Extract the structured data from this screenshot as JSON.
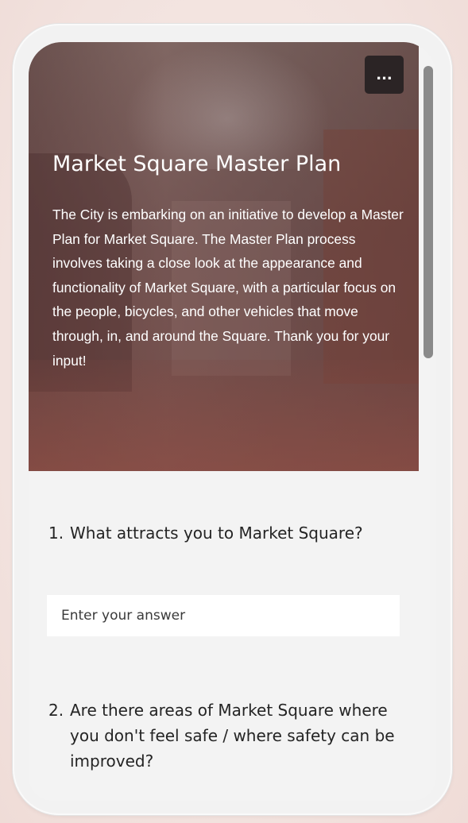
{
  "header": {
    "more_button_label": "...",
    "title": "Market Square Master Plan",
    "description": "The City is embarking on an initiative to develop a Master Plan for Market Square. The Master Plan process involves taking a close look at the appearance and functionality of Market Square, with a particular focus on the people, bicycles, and other vehicles that move through, in, and around the Square. Thank you for your input!"
  },
  "questions": [
    {
      "number": "1.",
      "text": "What attracts you to Market Square?",
      "placeholder": "Enter your answer"
    },
    {
      "number": "2.",
      "text": "Are there areas of Market Square where you don't feel safe / where safety can be improved?"
    }
  ],
  "colors": {
    "accent_button": "#2b2425",
    "hero_overlay": "#6b4a48",
    "form_background": "#f3f3f3"
  },
  "icons": {
    "more": "more-horizontal-icon"
  }
}
